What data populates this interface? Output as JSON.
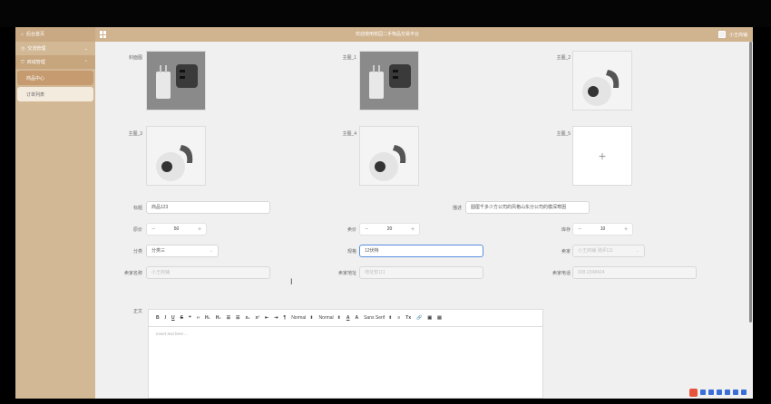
{
  "header": {
    "home_label": "后台首页",
    "title": "欢迎使用校园二手物品交易平台",
    "username": "小王商铺"
  },
  "sidebar": {
    "items": [
      {
        "label": "交流管理",
        "icon": "chat-icon"
      },
      {
        "label": "商城管理",
        "icon": "cart-icon"
      }
    ],
    "sub_items": [
      {
        "label": "商品中心"
      },
      {
        "label": "订单列表"
      }
    ]
  },
  "form": {
    "cover_label": "封面图",
    "main1_label": "主图_1",
    "main2_label": "主图_2",
    "main3_label": "主图_3",
    "main4_label": "主图_4",
    "main5_label": "主图_5",
    "upload_plus": "+",
    "title_label": "标题",
    "title_value": "商品123",
    "desc_label": "描述",
    "desc_value": "圆厘千多少方公司的风格山东分公司的模深寒困",
    "orig_price_label": "原价",
    "orig_price_value": "50",
    "sale_price_label": "卖价",
    "sale_price_value": "20",
    "stock_label": "库存",
    "stock_value": "10",
    "category_label": "分类",
    "category_value": "分类三",
    "spec_label": "规格",
    "spec_value": "12伏特",
    "seller_label": "卖家",
    "seller_value": "小王商铺 测评111",
    "seller_name_label": "卖家名称",
    "seller_name_value": "小王商铺",
    "seller_addr_label": "卖家地址",
    "seller_addr_value": "地址暂111",
    "seller_phone_label": "卖家电话",
    "seller_phone_value": "028-2348424",
    "content_label": "正文",
    "editor_placeholder": "Insert text here ...",
    "toolbar": {
      "bold": "B",
      "italic": "I",
      "underline": "U",
      "strike": "S",
      "quote": "❝",
      "code": "‹›",
      "h1": "H₁",
      "h2": "H₂",
      "ol": "☰",
      "ul": "☰",
      "sub": "x₂",
      "sup": "x²",
      "indent_l": "⇤",
      "indent_r": "⇥",
      "rtl": "¶",
      "size": "Normal",
      "header": "Normal",
      "color": "A",
      "bg": "A",
      "font": "Sans Serif",
      "align": "≡",
      "clean": "Tx",
      "link": "🔗",
      "image": "▣",
      "video": "▤"
    }
  },
  "colors": {
    "header": "#d0b38f",
    "sidebar": "#d3b895",
    "sub_selected": "#c59b6f",
    "focus": "#5a8fe0"
  }
}
